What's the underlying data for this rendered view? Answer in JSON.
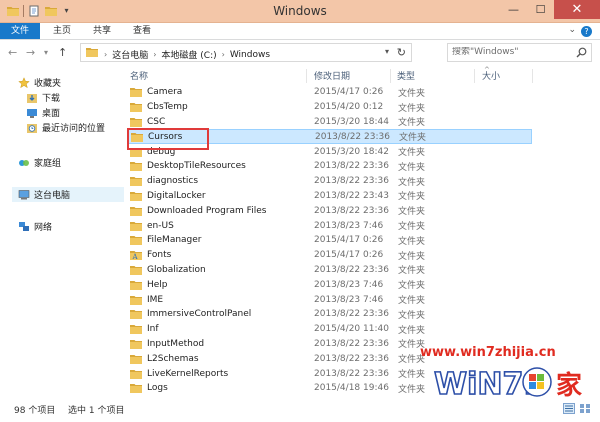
{
  "window": {
    "title": "Windows"
  },
  "ribbon": {
    "tabs": [
      "文件",
      "主页",
      "共享",
      "查看"
    ]
  },
  "address": {
    "crumbs": [
      "这台电脑",
      "本地磁盘 (C:)",
      "Windows"
    ]
  },
  "search": {
    "placeholder": "搜索\"Windows\""
  },
  "nav": {
    "favorites": "收藏夹",
    "downloads": "下载",
    "desktop": "桌面",
    "recent": "最近访问的位置",
    "homegroup": "家庭组",
    "this_pc": "这台电脑",
    "network": "网络"
  },
  "columns": {
    "name": "名称",
    "date": "修改日期",
    "type": "类型",
    "size": "大小"
  },
  "files": [
    {
      "name": "Camera",
      "date": "2015/4/17 0:26",
      "type": "文件夹",
      "icon": "folder-icon"
    },
    {
      "name": "CbsTemp",
      "date": "2015/4/20 0:12",
      "type": "文件夹",
      "icon": "folder-icon"
    },
    {
      "name": "CSC",
      "date": "2015/3/20 18:44",
      "type": "文件夹",
      "icon": "folder-icon"
    },
    {
      "name": "Cursors",
      "date": "2013/8/22 23:36",
      "type": "文件夹",
      "icon": "folder-icon",
      "selected": true
    },
    {
      "name": "debug",
      "date": "2015/3/20 18:42",
      "type": "文件夹",
      "icon": "folder-icon"
    },
    {
      "name": "DesktopTileResources",
      "date": "2013/8/22 23:36",
      "type": "文件夹",
      "icon": "folder-icon"
    },
    {
      "name": "diagnostics",
      "date": "2013/8/22 23:36",
      "type": "文件夹",
      "icon": "folder-icon"
    },
    {
      "name": "DigitalLocker",
      "date": "2013/8/22 23:43",
      "type": "文件夹",
      "icon": "folder-icon"
    },
    {
      "name": "Downloaded Program Files",
      "date": "2013/8/22 23:36",
      "type": "文件夹",
      "icon": "folder-icon"
    },
    {
      "name": "en-US",
      "date": "2013/8/23 7:46",
      "type": "文件夹",
      "icon": "folder-icon"
    },
    {
      "name": "FileManager",
      "date": "2015/4/17 0:26",
      "type": "文件夹",
      "icon": "folder-icon"
    },
    {
      "name": "Fonts",
      "date": "2015/4/17 0:26",
      "type": "文件夹",
      "icon": "fonts-folder-icon"
    },
    {
      "name": "Globalization",
      "date": "2013/8/22 23:36",
      "type": "文件夹",
      "icon": "folder-icon"
    },
    {
      "name": "Help",
      "date": "2013/8/23 7:46",
      "type": "文件夹",
      "icon": "folder-icon"
    },
    {
      "name": "IME",
      "date": "2013/8/23 7:46",
      "type": "文件夹",
      "icon": "folder-icon"
    },
    {
      "name": "ImmersiveControlPanel",
      "date": "2013/8/22 23:36",
      "type": "文件夹",
      "icon": "folder-icon"
    },
    {
      "name": "Inf",
      "date": "2015/4/20 11:40",
      "type": "文件夹",
      "icon": "folder-icon"
    },
    {
      "name": "InputMethod",
      "date": "2013/8/22 23:36",
      "type": "文件夹",
      "icon": "folder-icon"
    },
    {
      "name": "L2Schemas",
      "date": "2013/8/22 23:36",
      "type": "文件夹",
      "icon": "folder-icon"
    },
    {
      "name": "LiveKernelReports",
      "date": "2013/8/22 23:36",
      "type": "文件夹",
      "icon": "folder-icon"
    },
    {
      "name": "Logs",
      "date": "2015/4/18 19:46",
      "type": "文件夹",
      "icon": "folder-icon"
    }
  ],
  "status": {
    "count": "98 个项目",
    "selection": "选中 1 个项目"
  },
  "watermark": {
    "url": "www.win7zhijia.cn",
    "logo_text": "WiN7.",
    "logo_char": "家"
  },
  "colors": {
    "title_bar": "#f3c6a8",
    "file_tab": "#1979ca",
    "close_button": "#c7504b",
    "selection": "#cce8ff",
    "highlight_box": "#e03a3a",
    "folder": "#e8c15a"
  }
}
